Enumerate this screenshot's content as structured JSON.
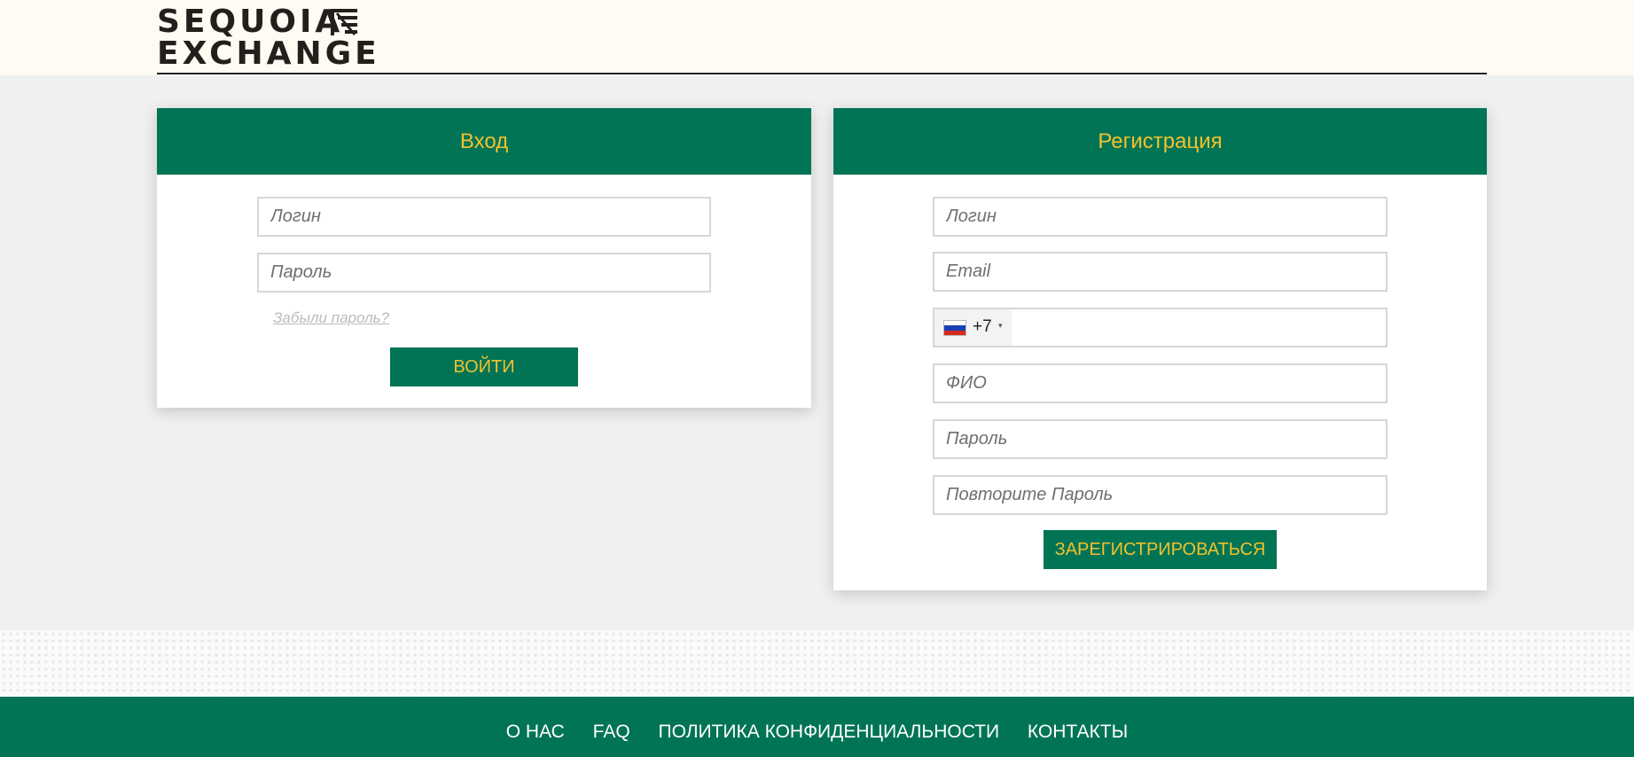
{
  "header": {
    "logo_line1": "SEQUOIA",
    "logo_line2": "EXCHANGE"
  },
  "login": {
    "title": "Вход",
    "login_placeholder": "Логин",
    "password_placeholder": "Пароль",
    "forgot_label": "Забыли пароль?",
    "submit_label": "ВОЙТИ"
  },
  "register": {
    "title": "Регистрация",
    "login_placeholder": "Логин",
    "email_placeholder": "Email",
    "phone": {
      "country_icon": "flag-russia-icon",
      "code": "+7",
      "caret": "▾",
      "value": ""
    },
    "fio_placeholder": "ФИО",
    "password_placeholder": "Пароль",
    "password_repeat_placeholder": "Повторите Пароль",
    "submit_label": "ЗАРЕГИСТРИРОВАТЬСЯ"
  },
  "footer": {
    "links": [
      "О НАС",
      "FAQ",
      "ПОЛИТИКА КОНФИДЕНЦИАЛЬНОСТИ",
      "КОНТАКТЫ"
    ]
  },
  "colors": {
    "brand_green": "#007455",
    "accent_yellow": "#f2c12e",
    "header_bg": "#fffbf2",
    "page_bg": "#f0f0f0"
  }
}
